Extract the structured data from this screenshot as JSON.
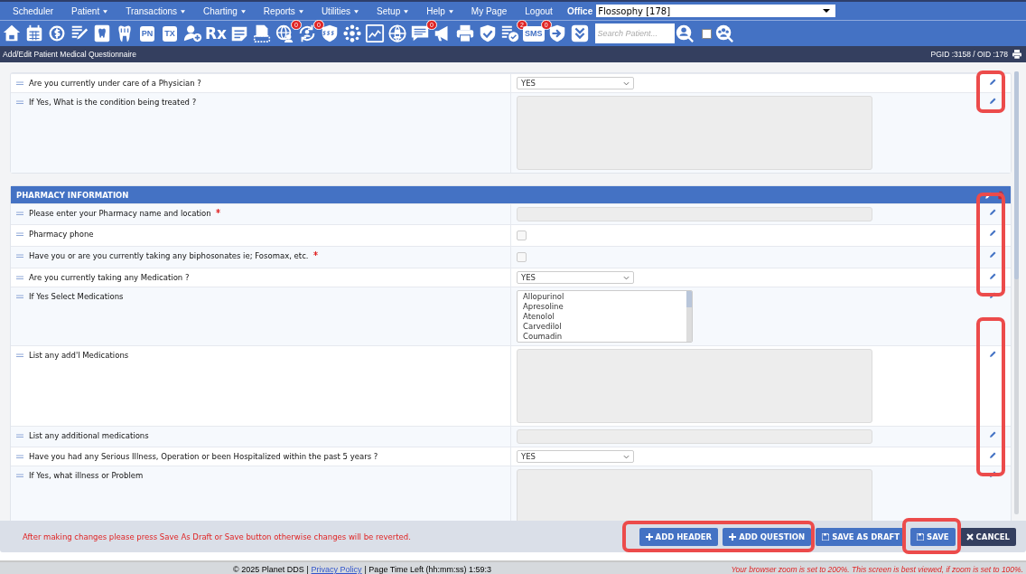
{
  "nav": {
    "items": [
      {
        "label": "Scheduler",
        "dropdown": false
      },
      {
        "label": "Patient",
        "dropdown": true
      },
      {
        "label": "Transactions",
        "dropdown": true
      },
      {
        "label": "Charting",
        "dropdown": true
      },
      {
        "label": "Reports",
        "dropdown": true
      },
      {
        "label": "Utilities",
        "dropdown": true
      },
      {
        "label": "Setup",
        "dropdown": true
      },
      {
        "label": "Help",
        "dropdown": true
      },
      {
        "label": "My Page",
        "dropdown": false
      },
      {
        "label": "Logout",
        "dropdown": false
      }
    ],
    "office_label": "Office",
    "office_value": "Flossophy [178]"
  },
  "toolbar": {
    "buttons": [
      {
        "kind": "icon"
      },
      {
        "kind": "icon"
      },
      {
        "kind": "icon"
      },
      {
        "kind": "icon"
      },
      {
        "kind": "icon"
      },
      {
        "kind": "icon"
      },
      {
        "kind": "text",
        "label": "PN"
      },
      {
        "kind": "text",
        "label": "TX"
      },
      {
        "kind": "icon"
      },
      {
        "kind": "text",
        "label": "Rx"
      },
      {
        "kind": "icon"
      },
      {
        "kind": "icon"
      },
      {
        "kind": "icon",
        "badge": "0"
      },
      {
        "kind": "icon",
        "badge": "0"
      },
      {
        "kind": "icon"
      },
      {
        "kind": "icon"
      },
      {
        "kind": "icon"
      },
      {
        "kind": "icon"
      },
      {
        "kind": "icon",
        "badge": "0"
      },
      {
        "kind": "icon"
      },
      {
        "kind": "icon"
      },
      {
        "kind": "icon"
      },
      {
        "kind": "icon",
        "badge": "2"
      },
      {
        "kind": "text",
        "label": "SMS",
        "badge": "0"
      },
      {
        "kind": "icon"
      },
      {
        "kind": "icon"
      }
    ],
    "search_placeholder": "Search Patient...",
    "family_checked": false
  },
  "title_bar": {
    "title": "Add/Edit Patient Medical Questionnaire",
    "ids": "PGID :3158  /  OID :178"
  },
  "sections": [
    {
      "rows": [
        {
          "label": "Are you currently under care of a Physician ?",
          "required": false,
          "kind": "select",
          "value": "YES"
        },
        {
          "label": "If Yes, What is the condition being treated ?",
          "required": false,
          "kind": "textarea"
        }
      ]
    },
    {
      "title": "PHARMACY INFORMATION",
      "rows": [
        {
          "label": "Please enter your Pharmacy name and location",
          "required": true,
          "kind": "text"
        },
        {
          "label": "Pharmacy phone",
          "required": false,
          "kind": "checkbox",
          "checked": false
        },
        {
          "label": "Have you or are you currently taking any biphosonates ie; Fosomax, etc.",
          "required": true,
          "kind": "checkbox",
          "checked": false
        },
        {
          "label": "Are you currently taking any Medication ?",
          "required": false,
          "kind": "select",
          "value": "YES"
        },
        {
          "label": "If Yes Select Medications",
          "required": false,
          "kind": "listbox",
          "options": [
            "Allopurinol",
            "Apresoline",
            "Atenolol",
            "Carvedilol",
            "Coumadin"
          ]
        },
        {
          "label": "List any add'l Medications",
          "required": false,
          "kind": "textarea"
        },
        {
          "label": "List any additional medications",
          "required": false,
          "kind": "text"
        },
        {
          "label": "Have you had any Serious Illness, Operation or been Hospitalized within the past 5 years ?",
          "required": false,
          "kind": "select",
          "value": "YES"
        },
        {
          "label": "If Yes, what illness or Problem",
          "required": false,
          "kind": "textarea"
        }
      ]
    }
  ],
  "action_bar": {
    "message": "After making changes please press Save As Draft or Save button otherwise changes will be reverted.",
    "buttons": [
      {
        "label": "ADD HEADER",
        "kind": "add"
      },
      {
        "label": "ADD QUESTION",
        "kind": "add"
      },
      {
        "label": "SAVE AS DRAFT",
        "kind": "save"
      },
      {
        "label": "SAVE",
        "kind": "save"
      },
      {
        "label": "CANCEL",
        "kind": "cancel"
      }
    ]
  },
  "status_bar": {
    "copyright": "© 2025 Planet DDS |",
    "privacy_link": "Privacy Policy",
    "time_left": "| Page Time Left (hh:mm:ss) 1:59:3",
    "zoom_warning": "Your browser zoom is set to 200%. This screen is best viewed, if zoom is set to 100%."
  }
}
